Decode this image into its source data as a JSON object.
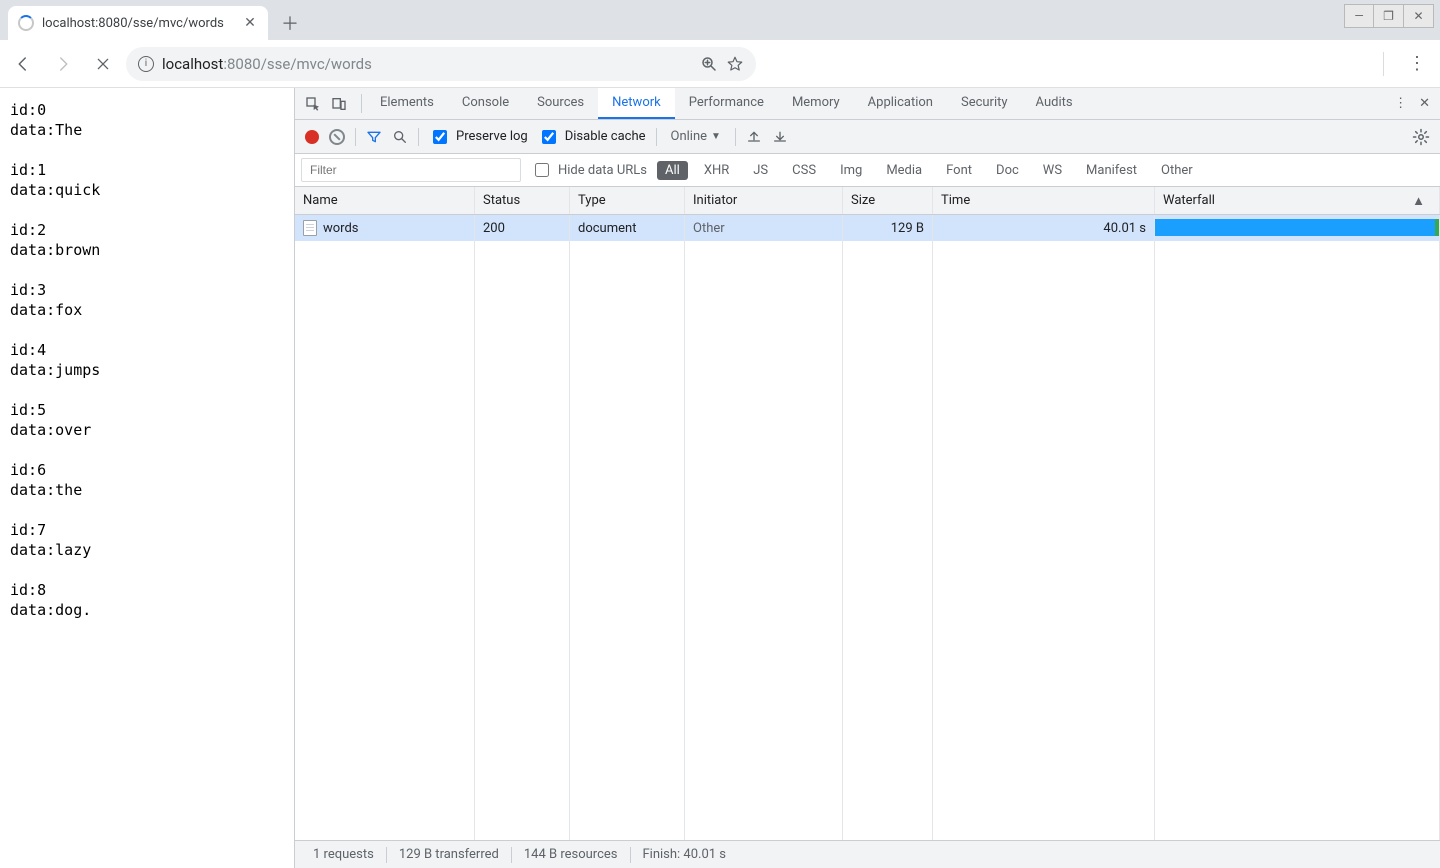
{
  "browser": {
    "tab_title": "localhost:8080/sse/mvc/words",
    "url_host": "localhost",
    "url_port": ":8080",
    "url_path": "/sse/mvc/words"
  },
  "page_sse": [
    {
      "id": "id:0",
      "data": "data:The"
    },
    {
      "id": "id:1",
      "data": "data:quick"
    },
    {
      "id": "id:2",
      "data": "data:brown"
    },
    {
      "id": "id:3",
      "data": "data:fox"
    },
    {
      "id": "id:4",
      "data": "data:jumps"
    },
    {
      "id": "id:5",
      "data": "data:over"
    },
    {
      "id": "id:6",
      "data": "data:the"
    },
    {
      "id": "id:7",
      "data": "data:lazy"
    },
    {
      "id": "id:8",
      "data": "data:dog."
    }
  ],
  "devtools": {
    "tabs": [
      "Elements",
      "Console",
      "Sources",
      "Network",
      "Performance",
      "Memory",
      "Application",
      "Security",
      "Audits"
    ],
    "active_tab": "Network"
  },
  "network_toolbar": {
    "preserve_log_label": "Preserve log",
    "preserve_log_checked": true,
    "disable_cache_label": "Disable cache",
    "disable_cache_checked": true,
    "throttle": "Online"
  },
  "filter_bar": {
    "placeholder": "Filter",
    "hide_data_urls_label": "Hide data URLs",
    "hide_data_urls_checked": false,
    "types": [
      "All",
      "XHR",
      "JS",
      "CSS",
      "Img",
      "Media",
      "Font",
      "Doc",
      "WS",
      "Manifest",
      "Other"
    ],
    "active_type": "All"
  },
  "table": {
    "headers": {
      "name": "Name",
      "status": "Status",
      "type": "Type",
      "initiator": "Initiator",
      "size": "Size",
      "time": "Time",
      "waterfall": "Waterfall"
    },
    "rows": [
      {
        "name": "words",
        "status": "200",
        "type": "document",
        "initiator": "Other",
        "size": "129 B",
        "time": "40.01 s"
      }
    ]
  },
  "statusbar": {
    "requests": "1 requests",
    "transferred": "129 B transferred",
    "resources": "144 B resources",
    "finish": "Finish: 40.01 s"
  }
}
